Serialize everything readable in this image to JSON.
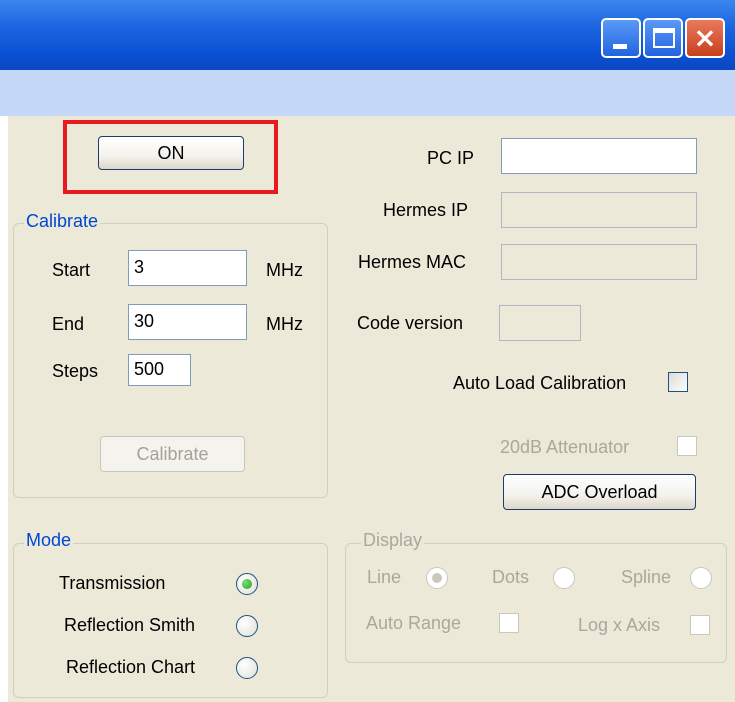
{
  "window": {
    "controls": {
      "minimize": "minimize-icon",
      "maximize": "maximize-icon",
      "close": "close-icon"
    }
  },
  "power": {
    "label": "ON"
  },
  "calibrate": {
    "title": "Calibrate",
    "start_label": "Start",
    "start_value": "3",
    "start_unit": "MHz",
    "end_label": "End",
    "end_value": "30",
    "end_unit": "MHz",
    "steps_label": "Steps",
    "steps_value": "500",
    "button": "Calibrate"
  },
  "network": {
    "pc_ip_label": "PC IP",
    "pc_ip_value": "",
    "hermes_ip_label": "Hermes IP",
    "hermes_ip_value": "",
    "hermes_mac_label": "Hermes MAC",
    "hermes_mac_value": "",
    "code_version_label": "Code version",
    "code_version_value": ""
  },
  "options": {
    "auto_load_label": "Auto Load Calibration",
    "auto_load_checked": false,
    "attenuator_label": "20dB Attenuator",
    "attenuator_checked": false,
    "adc_button": "ADC Overload"
  },
  "mode": {
    "title": "Mode",
    "items": [
      {
        "label": "Transmission",
        "selected": true
      },
      {
        "label": "Reflection Smith",
        "selected": false
      },
      {
        "label": "Reflection Chart",
        "selected": false
      }
    ]
  },
  "display": {
    "title": "Display",
    "line_label": "Line",
    "dots_label": "Dots",
    "spline_label": "Spline",
    "selected": "Line",
    "auto_range_label": "Auto Range",
    "log_x_label": "Log x Axis"
  },
  "colors": {
    "highlight": "#e8191f",
    "group_title": "#0046d5",
    "titlebar": "#0a4fd2"
  }
}
